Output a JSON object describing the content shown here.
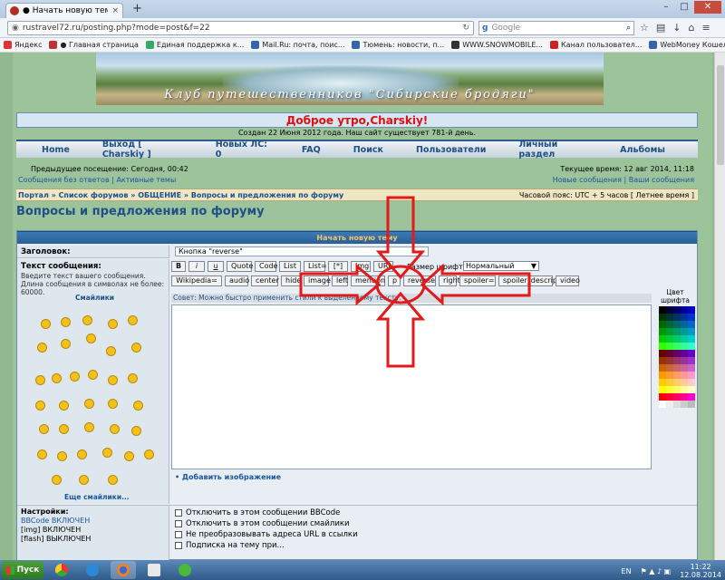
{
  "browser": {
    "tab_title": "● Начать новую тему",
    "tab_close": "×",
    "new_tab": "+",
    "url": "rustravel72.ru/posting.php?mode=post&f=22",
    "search_engine": "Google",
    "search_placeholder": "Google",
    "win_min": "–",
    "win_max": "□",
    "win_close": "✕"
  },
  "bookmarks": [
    {
      "label": "Яндекс",
      "color": "#d33"
    },
    {
      "label": "● Главная страница",
      "color": "#b33"
    },
    {
      "label": "Единая поддержка к...",
      "color": "#3a6"
    },
    {
      "label": "Mail.Ru: почта, поис...",
      "color": "#36a"
    },
    {
      "label": "Тюмень: новости, п...",
      "color": "#36a"
    },
    {
      "label": "WWW.SNOWMOBILE...",
      "color": "#333"
    },
    {
      "label": "Канал пользовател...",
      "color": "#c22"
    },
    {
      "label": "WebMoney Кошелёк ...",
      "color": "#36a"
    }
  ],
  "site": {
    "banner_title": "Клуб путешественников \"Сибирские бродяги\"",
    "greeting": "Доброе утро,Charskiy!",
    "created": "Создан 22 Июня 2012 года. Наш сайт существует 781-й день.",
    "menu": [
      "Home",
      "Выход [ Charskiy ]",
      "Новых ЛС: 0",
      "FAQ",
      "Поиск",
      "Пользователи",
      "Личный раздел",
      "Альбомы"
    ],
    "last_visit": "Предыдущее посещение: Сегодня, 00:42",
    "current_time": "Текущее время: 12 авг 2014, 11:18",
    "links_left": "Сообщения без ответов | Активные темы",
    "links_right": "Новые сообщения | Ваши сообщения",
    "breadcrumb": "Портал » Список форумов » ОБЩЕНИЕ » Вопросы и предложения по форуму",
    "timezone": "Часовой пояс: UTC + 5 часов [ Летнее время ]",
    "page_title": "Вопросы и предложения по форуму"
  },
  "form": {
    "header": "Начать новую тему",
    "subject_label": "Заголовок:",
    "subject_value": "Кнопка \"reverse\"",
    "message_label": "Текст сообщения:",
    "message_desc": "Введите текст вашего сообщения. Длина сообщения в символах не более: 60000.",
    "smilies_title": "Смайлики",
    "more_smilies": "Еще смайлики...",
    "buttons_row1": [
      "B",
      "i",
      "u",
      "Quote",
      "Code",
      "List",
      "List=",
      "[*]",
      "Img",
      "URL"
    ],
    "font_size_label": "Размер шрифта:",
    "font_size_value": "Нормальный",
    "buttons_row2": [
      "Wikipedia=",
      "audio",
      "center",
      "hide",
      "image",
      "left",
      "mention",
      "p",
      "reverse",
      "right",
      "spoiler=",
      "spoiler_descrip",
      "video"
    ],
    "hint": "Совет: Можно быстро применить стили к выделенному тексту.",
    "add_image": "• Добавить изображение",
    "color_label": "Цвет шрифта",
    "settings_label": "Настройки:",
    "settings_lines": [
      "BBCode ВКЛЮЧЕН",
      "[img] ВКЛЮЧЕН",
      "[flash] ВЫКЛЮЧЕН"
    ],
    "checks": [
      "Отключить в этом сообщении BBCode",
      "Отключить в этом сообщении смайлики",
      "Не преобразовывать адреса URL в ссылки",
      "Подписка на тему при..."
    ]
  },
  "taskbar": {
    "start": "Пуск",
    "lang": "EN",
    "time": "11:22",
    "date": "12.08.2014"
  },
  "colors": {
    "page_bg": "#9dc39a",
    "accent": "#1f4f86",
    "annotation": "#e21a1a",
    "greeting": "#e01010"
  }
}
